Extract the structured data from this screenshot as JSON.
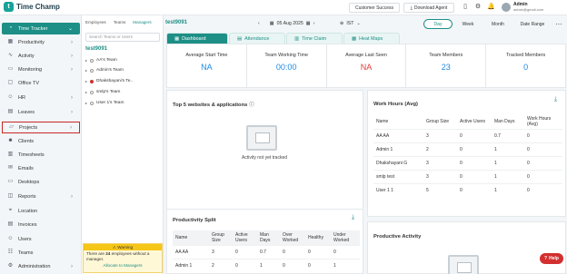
{
  "app": {
    "name": "Time Champ",
    "logo_letter": "t"
  },
  "topbar": {
    "customer_success": "Customer Success",
    "download_agent": "Download Agent",
    "user_name": "Admin",
    "user_email": "admin@gmail.com"
  },
  "sidebar": {
    "items": [
      {
        "label": "Time Tracker",
        "icon": "clock-icon"
      },
      {
        "label": "Productivity",
        "icon": "chart-icon"
      },
      {
        "label": "Activity",
        "icon": "activity-icon"
      },
      {
        "label": "Monitoring",
        "icon": "monitor-icon"
      },
      {
        "label": "Office TV",
        "icon": "tv-icon"
      },
      {
        "label": "HR",
        "icon": "hr-icon"
      },
      {
        "label": "Leaves",
        "icon": "calendar-icon"
      },
      {
        "label": "Projects",
        "icon": "folder-icon"
      },
      {
        "label": "Clients",
        "icon": "clients-icon"
      },
      {
        "label": "Timesheets",
        "icon": "timesheet-icon"
      },
      {
        "label": "Emails",
        "icon": "mail-icon"
      },
      {
        "label": "Desktops",
        "icon": "desktop-icon"
      },
      {
        "label": "Reports",
        "icon": "report-icon"
      },
      {
        "label": "Location",
        "icon": "location-icon"
      },
      {
        "label": "Invoices",
        "icon": "invoice-icon"
      },
      {
        "label": "Users",
        "icon": "users-icon"
      },
      {
        "label": "Teams",
        "icon": "teams-icon"
      },
      {
        "label": "Administration",
        "icon": "admin-icon"
      }
    ]
  },
  "team_panel": {
    "tabs": [
      "Employees",
      "Teams",
      "Managers"
    ],
    "search_placeholder": "Search Teams or Users",
    "title": "test9091",
    "teams": [
      "AA's Team",
      "Admin's Team",
      "Dhakshayani's Te..",
      "smlp's Team",
      "User 1's Team"
    ],
    "warning": {
      "head": "Warning",
      "text_pre": "There are",
      "count": "24",
      "text_post": "employees without a manager.",
      "link": "Allocate to Managers"
    }
  },
  "main": {
    "title": "test9091",
    "date": "05 Aug 2025",
    "timezone": "IST",
    "range": {
      "day": "Day",
      "week": "Week",
      "month": "Month",
      "date_range": "Date Range"
    },
    "tabs": [
      "Dashboard",
      "Attendance",
      "Time Claim",
      "Heat Maps"
    ],
    "stats": [
      {
        "label": "Average Start Time",
        "value": "NA",
        "color": "#1e88e5"
      },
      {
        "label": "Team Working Time",
        "value": "00:00",
        "color": "#1e88e5"
      },
      {
        "label": "Average Last Seen",
        "value": "NA",
        "color": "#e53935"
      },
      {
        "label": "Team Members",
        "value": "23",
        "color": "#1e88e5"
      },
      {
        "label": "Tracked Members",
        "value": "0",
        "color": "#1e88e5"
      }
    ],
    "top_websites": {
      "title": "Top 5 websites & applications",
      "empty_text": "Activity not yet tracked"
    },
    "work_hours": {
      "title": "Work Hours (Avg)",
      "headers": [
        "Name",
        "Group Size",
        "Active Users",
        "Man Days",
        "Work Hours (Avg)"
      ],
      "rows": [
        [
          "AA AA",
          "3",
          "0",
          "0.7",
          "0"
        ],
        [
          "Admin 1",
          "2",
          "0",
          "1",
          "0"
        ],
        [
          "Dhakshayani G",
          "3",
          "0",
          "1",
          "0"
        ],
        [
          "smlp test",
          "3",
          "0",
          "1",
          "0"
        ],
        [
          "User 1 1",
          "5",
          "0",
          "1",
          "0"
        ]
      ]
    },
    "productivity_split": {
      "title": "Productivity Split",
      "headers": [
        "Name",
        "Group Size",
        "Active Users",
        "Man Days",
        "Over Worked",
        "Healthy",
        "Under Worked"
      ],
      "rows": [
        [
          "AA AA",
          "3",
          "0",
          "0.7",
          "0",
          "0",
          "0"
        ],
        [
          "Admin 1",
          "2",
          "0",
          "1",
          "0",
          "0",
          "1"
        ]
      ]
    },
    "productive_activity": {
      "title": "Productive Activity"
    }
  },
  "help": {
    "label": "Help"
  },
  "colors": {
    "accent": "#1d8f86",
    "warning": "#f5c518",
    "help": "#d32f2f"
  }
}
